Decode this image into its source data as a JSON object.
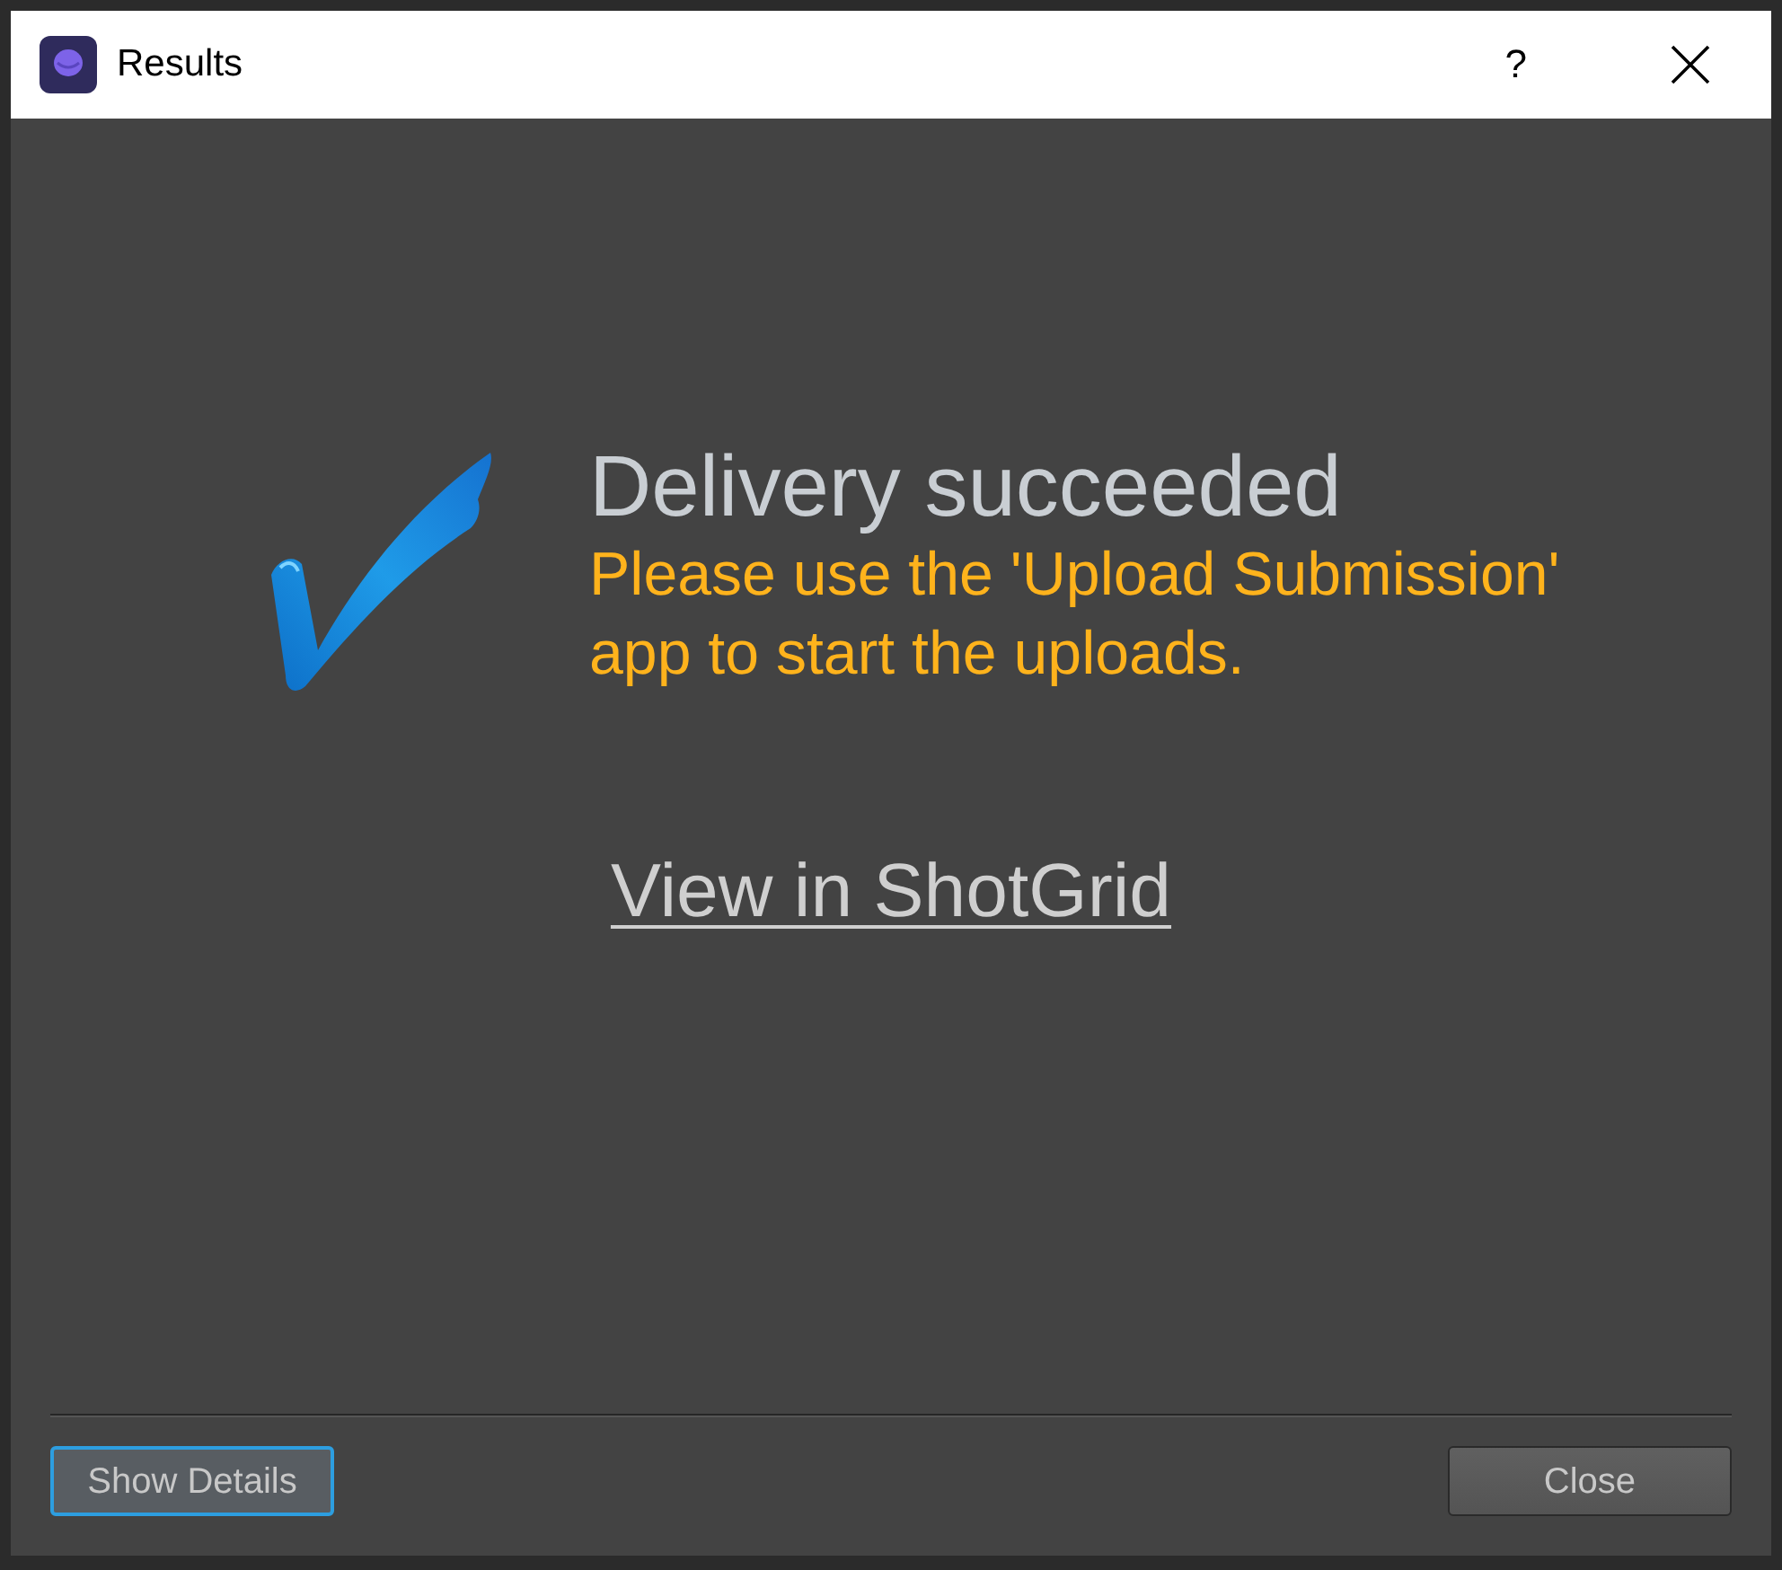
{
  "window": {
    "title": "Results",
    "help_button": "?"
  },
  "result": {
    "kind": "success",
    "heading": "Delivery succeeded",
    "message": "Please use the 'Upload Submission' app to start the uploads.",
    "link": "View in ShotGrid"
  },
  "buttons": [
    {
      "label": "Show Details",
      "focused": true
    },
    {
      "label": "Close",
      "focused": false
    }
  ]
}
